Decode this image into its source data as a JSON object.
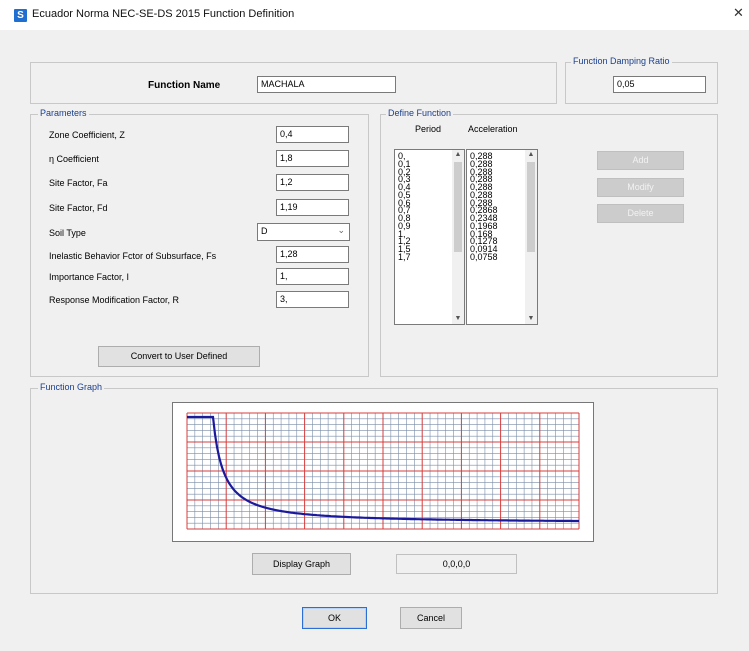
{
  "window": {
    "app_icon": "S",
    "title": "Ecuador Norma NEC-SE-DS 2015 Function Definition",
    "close_glyph": "✕"
  },
  "function_name": {
    "label": "Function Name",
    "value": "MACHALA"
  },
  "damping": {
    "title": "Function Damping Ratio",
    "value": "0,05"
  },
  "parameters": {
    "title": "Parameters",
    "fields": [
      {
        "label": "Zone Coefficient, Z",
        "value": "0,4"
      },
      {
        "label": "η Coefficient",
        "value": "1,8"
      },
      {
        "label": "Site Factor, Fa",
        "value": "1,2"
      },
      {
        "label": "Site Factor, Fd",
        "value": "1,19"
      },
      {
        "label": "Soil Type",
        "value": "D"
      },
      {
        "label": "Inelastic Behavior Fctor of Subsurface, Fs",
        "value": "1,28"
      },
      {
        "label": "Importance Factor, I",
        "value": "1,"
      },
      {
        "label": "Response Modification Factor, R",
        "value": "3,"
      }
    ],
    "convert_button": "Convert to User Defined"
  },
  "define_function": {
    "title": "Define Function",
    "period_header": "Period",
    "acceleration_header": "Acceleration",
    "periods": [
      "0,",
      "0,1",
      "0,2",
      "0,3",
      "0,4",
      "0,5",
      "0,6",
      "0,7",
      "0,8",
      "0,9",
      "1,",
      "1,2",
      "1,5",
      "1,7"
    ],
    "accelerations": [
      "0,288",
      "0,288",
      "0,288",
      "0,288",
      "0,288",
      "0,288",
      "0,288",
      "0,2868",
      "0,2348",
      "0,1968",
      "0,168",
      "0,1278",
      "0,0914",
      "0,0758"
    ],
    "add_button": "Add",
    "modify_button": "Modify",
    "delete_button": "Delete"
  },
  "graph": {
    "title": "Function Graph",
    "display_button": "Display Graph",
    "coords": "0,0,0,0"
  },
  "footer": {
    "ok": "OK",
    "cancel": "Cancel"
  },
  "colors": {
    "graph_bg": "#ffffff",
    "minor_grid": "#7a8ea8",
    "major_grid": "#d43c3c",
    "curve": "#1c1a9c",
    "group_title": "#1a3f8f"
  }
}
